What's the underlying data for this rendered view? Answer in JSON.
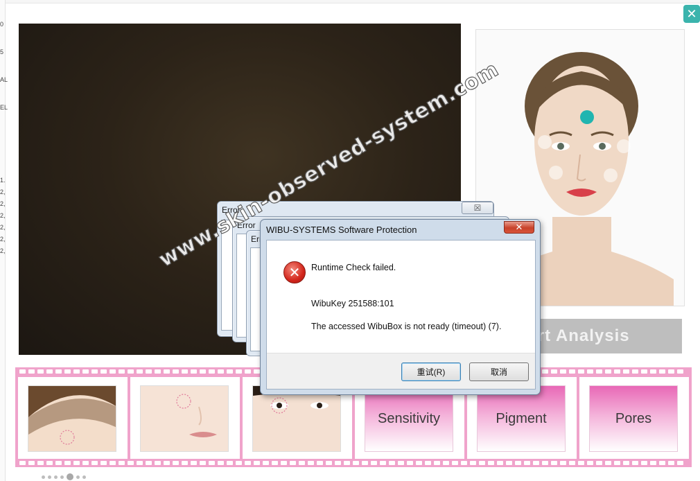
{
  "background": {
    "left_fragments": [
      "0",
      "5",
      "AL",
      "EL",
      "1.",
      "2,",
      "2,",
      "2,",
      "2,",
      "2,",
      "2,"
    ]
  },
  "close_button": {
    "label": "✕"
  },
  "start_button": {
    "label": "Start Analysis",
    "visible_label": "art Analysis"
  },
  "film_strip": {
    "tiles": [
      {
        "type": "photo",
        "name": "forehead"
      },
      {
        "type": "photo",
        "name": "cheek"
      },
      {
        "type": "photo",
        "name": "eye"
      },
      {
        "type": "tile",
        "label": "Sensitivity"
      },
      {
        "type": "tile",
        "label": "Pigment"
      },
      {
        "type": "tile",
        "label": "Pores"
      }
    ],
    "pager_dots": 7,
    "active_dot": 4
  },
  "error_windows": [
    {
      "title": "Error"
    },
    {
      "title": "Error"
    },
    {
      "title": "Err"
    }
  ],
  "dialog": {
    "title": "WIBU-SYSTEMS Software Protection",
    "close_label": "✕",
    "icon": "error-icon",
    "line1": "Runtime Check failed.",
    "line2": "WibuKey 251588:101",
    "line3": "The accessed WibuBox is not ready (timeout) (7).",
    "retry_button": "重试(R)",
    "cancel_button": "取消"
  },
  "watermark": "www.skin-observed-system.com",
  "colors": {
    "accent_teal": "#3bb4ad",
    "film_pink": "#f0a3cb",
    "tile_pink": "#e868b6",
    "error_red": "#d3261c"
  }
}
